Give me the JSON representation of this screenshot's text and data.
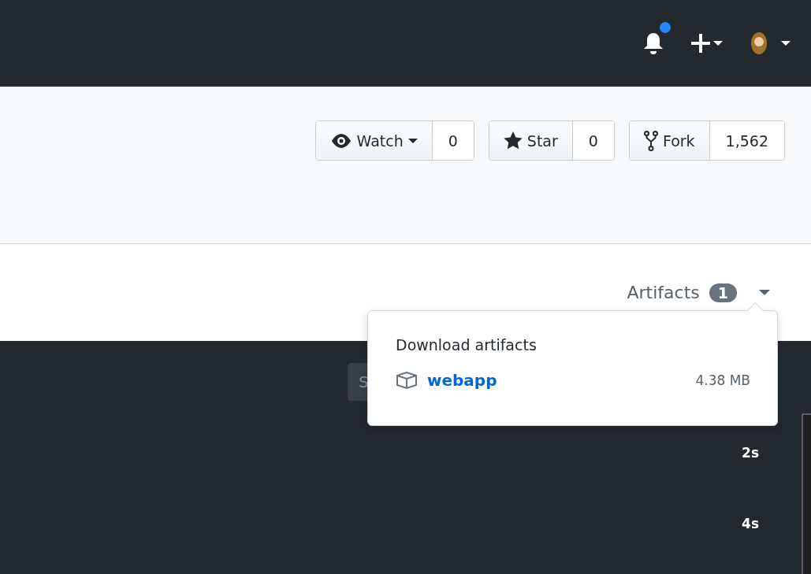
{
  "header": {
    "notification": {
      "unread": true
    }
  },
  "repo_actions": [
    {
      "kind": "watch",
      "label": "Watch",
      "count": "0"
    },
    {
      "kind": "star",
      "label": "Star",
      "count": "0"
    },
    {
      "kind": "fork",
      "label": "Fork",
      "count": "1,562"
    }
  ],
  "artifacts": {
    "label": "Artifacts",
    "count": "1",
    "expanded": true
  },
  "popover": {
    "title": "Download artifacts",
    "items": [
      {
        "name": "webapp",
        "size": "4.38 MB"
      }
    ]
  },
  "log": {
    "search": {
      "placeholder": "S"
    },
    "steps": [
      {
        "duration": "2s"
      },
      {
        "duration": "4s"
      }
    ]
  }
}
